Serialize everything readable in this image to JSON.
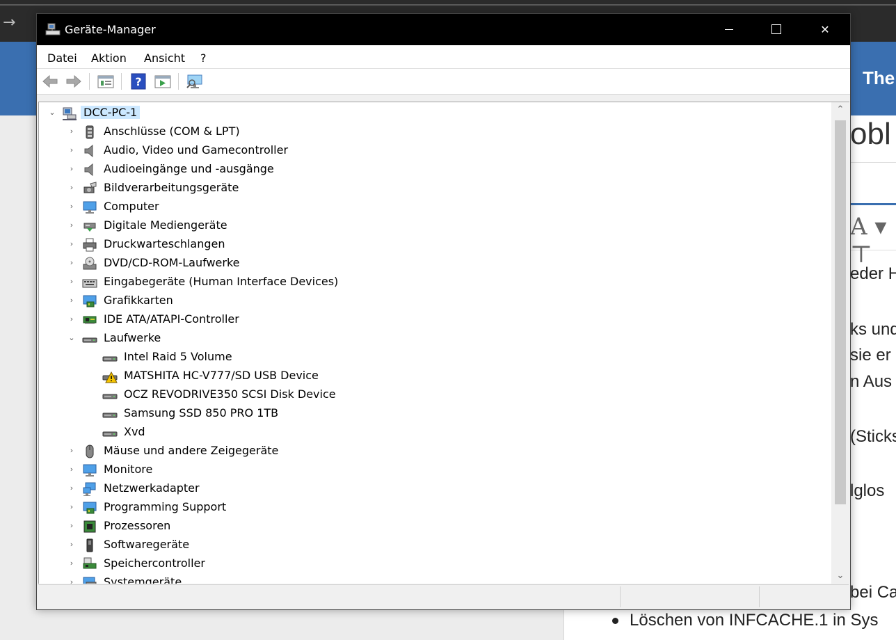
{
  "window": {
    "title": "Geräte-Manager",
    "close_glyph": "✕"
  },
  "menu": [
    "Datei",
    "Aktion",
    "Ansicht",
    "?"
  ],
  "toolbar": {
    "buttons": [
      "back-arrow-icon",
      "forward-arrow-icon",
      "properties-icon",
      "help-icon",
      "update-driver-icon",
      "scan-hardware-icon"
    ]
  },
  "tree": {
    "root": "DCC-PC-1",
    "categories": [
      {
        "label": "Anschlüsse (COM & LPT)",
        "icon": "port-icon"
      },
      {
        "label": "Audio, Video und Gamecontroller",
        "icon": "speaker-icon"
      },
      {
        "label": "Audioeingänge und -ausgänge",
        "icon": "speaker-icon"
      },
      {
        "label": "Bildverarbeitungsgeräte",
        "icon": "camera-icon"
      },
      {
        "label": "Computer",
        "icon": "computer-icon"
      },
      {
        "label": "Digitale Mediengeräte",
        "icon": "media-device-icon"
      },
      {
        "label": "Druckwarteschlangen",
        "icon": "printer-icon"
      },
      {
        "label": "DVD/CD-ROM-Laufwerke",
        "icon": "dvd-icon"
      },
      {
        "label": "Eingabegeräte (Human Interface Devices)",
        "icon": "keyboard-icon"
      },
      {
        "label": "Grafikkarten",
        "icon": "display-adapter-icon"
      },
      {
        "label": "IDE ATA/ATAPI-Controller",
        "icon": "controller-icon"
      },
      {
        "label": "Laufwerke",
        "icon": "disk-drive-icon",
        "expanded": true,
        "children": [
          {
            "label": "Intel Raid 5 Volume",
            "icon": "disk-drive-icon"
          },
          {
            "label": "MATSHITA HC-V777/SD USB Device",
            "icon": "disk-drive-warning-icon"
          },
          {
            "label": "OCZ REVODRIVE350 SCSI Disk Device",
            "icon": "disk-drive-icon"
          },
          {
            "label": "Samsung SSD 850 PRO 1TB",
            "icon": "disk-drive-icon"
          },
          {
            "label": "Xvd",
            "icon": "disk-drive-icon"
          }
        ]
      },
      {
        "label": "Mäuse und andere Zeigegeräte",
        "icon": "mouse-icon"
      },
      {
        "label": "Monitore",
        "icon": "monitor-icon"
      },
      {
        "label": "Netzwerkadapter",
        "icon": "network-adapter-icon"
      },
      {
        "label": "Programming Support",
        "icon": "display-adapter-icon"
      },
      {
        "label": "Prozessoren",
        "icon": "processor-icon"
      },
      {
        "label": "Softwaregeräte",
        "icon": "software-device-icon"
      },
      {
        "label": "Speichercontroller",
        "icon": "storage-controller-icon"
      },
      {
        "label": "Systemgeräte",
        "icon": "system-device-icon"
      }
    ]
  },
  "background": {
    "band_text": "The",
    "heading": "obl",
    "toolbar_glyph": "A ▾ ⊤",
    "lines": [
      "eder H",
      "ks und",
      " sie er",
      "n Aus",
      "(Sticks",
      "lglos",
      "bei Ca"
    ],
    "bullet": "Löschen von INFCACHE.1 in Sys"
  }
}
